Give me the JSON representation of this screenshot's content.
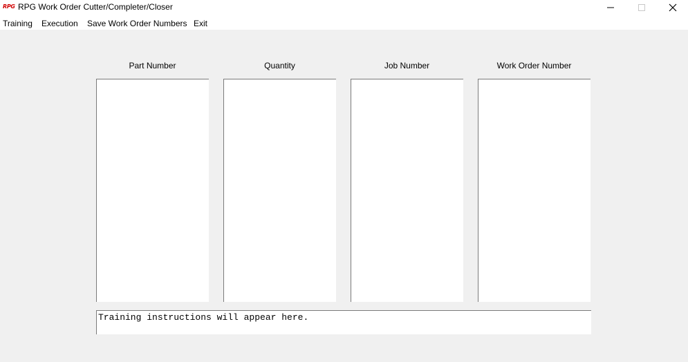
{
  "window": {
    "logo_text": "RPG",
    "title": "RPG Work Order Cutter/Completer/Closer",
    "controls": {
      "minimize": "minimize-icon",
      "maximize": "maximize-icon",
      "close": "close-icon"
    }
  },
  "menu": {
    "training": "Training",
    "execution": "Execution",
    "save_work_order_numbers": "Save Work Order Numbers",
    "exit": "Exit"
  },
  "columns": [
    {
      "header": "Part Number",
      "items": []
    },
    {
      "header": "Quantity",
      "items": []
    },
    {
      "header": "Job Number",
      "items": []
    },
    {
      "header": "Work Order Number",
      "items": []
    }
  ],
  "instructions": {
    "text": "Training instructions will appear here."
  },
  "colors": {
    "background": "#f0f0f0",
    "titlebar": "#ffffff",
    "logo": "#d10000",
    "field_border": "#7a7a7a"
  }
}
